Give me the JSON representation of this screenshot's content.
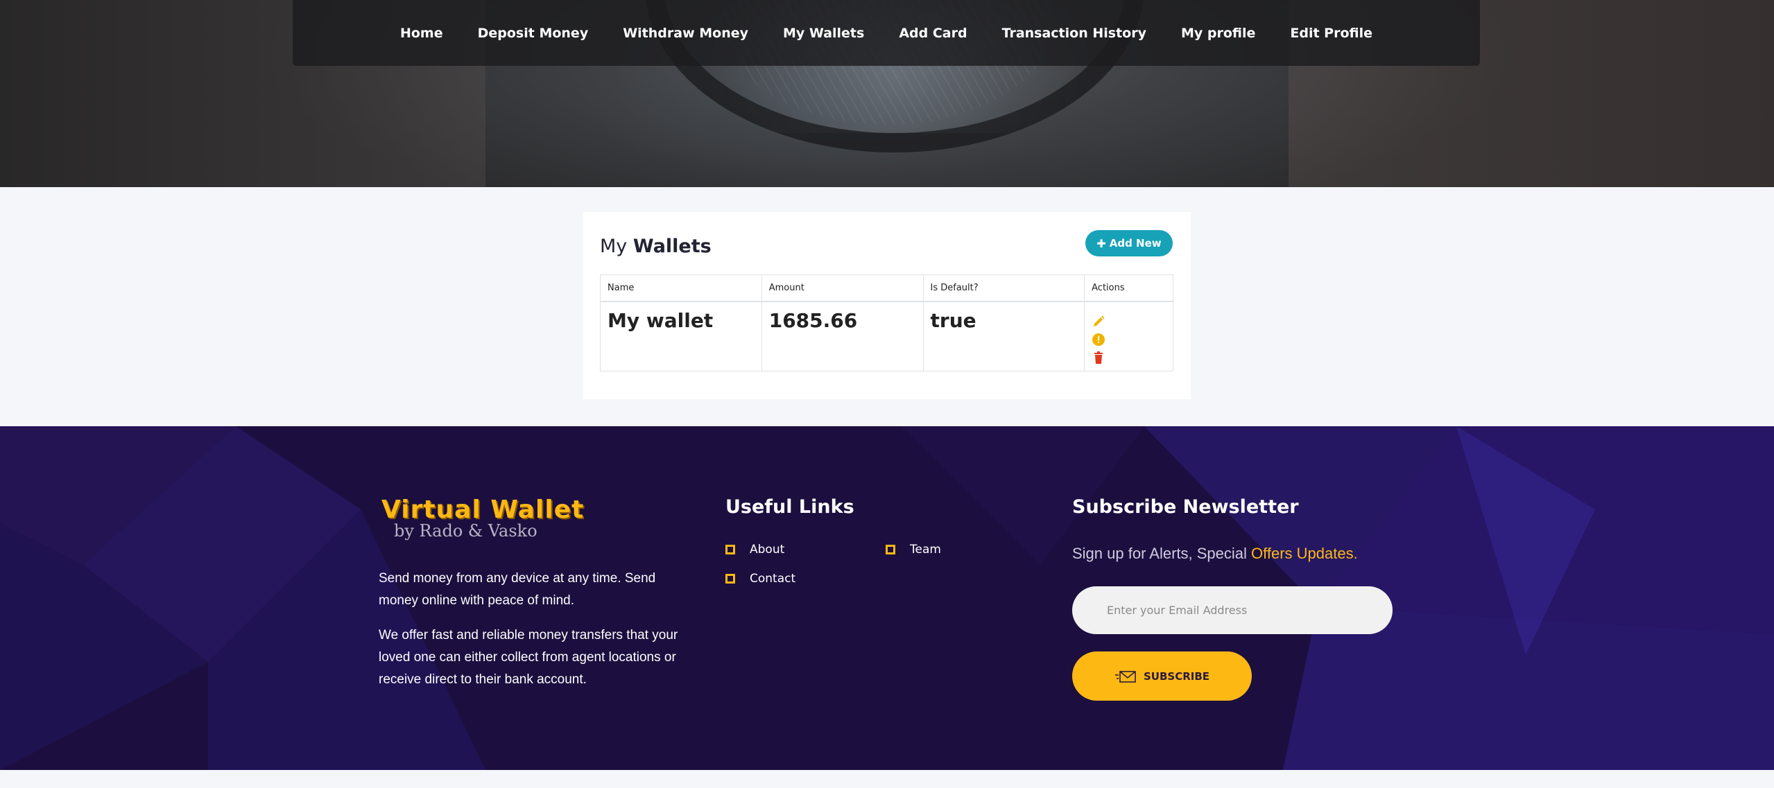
{
  "nav": {
    "items": [
      "Home",
      "Deposit Money",
      "Withdraw Money",
      "My Wallets",
      "Add Card",
      "Transaction History",
      "My profile",
      "Edit Profile"
    ]
  },
  "wallets_card": {
    "title_prefix": "My",
    "title_bold": "Wallets",
    "add_button_label": "Add New",
    "columns": [
      "Name",
      "Amount",
      "Is Default?",
      "Actions"
    ],
    "rows": [
      {
        "name": "My wallet",
        "amount": "1685.66",
        "is_default": "true"
      }
    ],
    "action_icons": [
      "pencil-icon",
      "alert-circle-icon",
      "trash-icon"
    ]
  },
  "footer": {
    "logo_title": "Virtual Wallet",
    "logo_subtitle": "by Rado & Vasko",
    "about_p1": "Send money from any device at any time. Send money online with peace of mind.",
    "about_p2": "We offer fast and reliable money transfers that your loved one can either collect from agent locations or receive direct to their bank account.",
    "useful_links_heading": "Useful Links",
    "links": [
      "About",
      "Team",
      "Contact"
    ],
    "newsletter_heading": "Subscribe Newsletter",
    "signup_text": "Sign up for Alerts, Special ",
    "signup_highlight": "Offers Updates.",
    "email_placeholder": "Enter your Email Address",
    "subscribe_label": "SUBSCRIBE"
  },
  "colors": {
    "accent_yellow": "#fdb813",
    "teal_button": "#17a2b8",
    "footer_bg": "#1c0f3f",
    "delete_red": "#e03a1e"
  }
}
